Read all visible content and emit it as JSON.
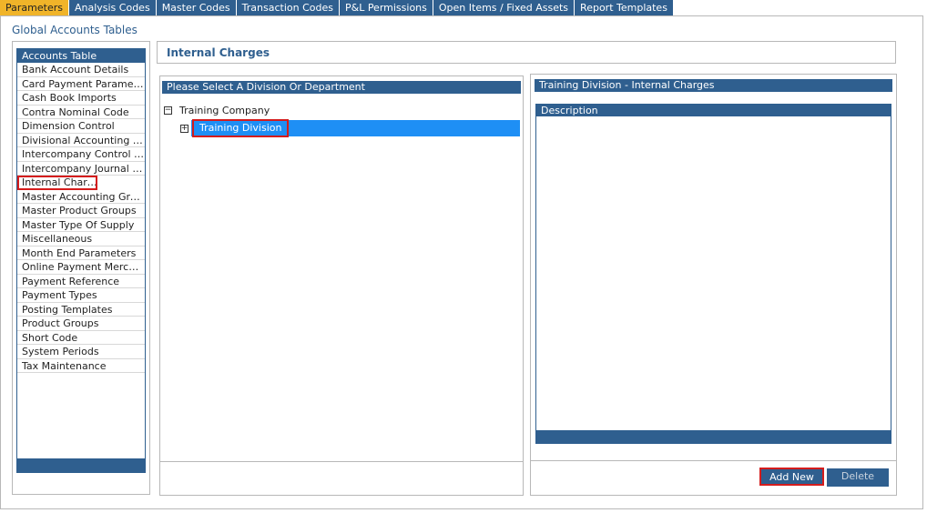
{
  "tabs": [
    {
      "label": "Parameters",
      "active": true
    },
    {
      "label": "Analysis Codes"
    },
    {
      "label": "Master Codes"
    },
    {
      "label": "Transaction Codes"
    },
    {
      "label": "P&L Permissions"
    },
    {
      "label": "Open Items / Fixed Assets"
    },
    {
      "label": "Report Templates"
    }
  ],
  "section_title": "Global Accounts Tables",
  "sidebar": {
    "header": "Accounts Table",
    "items": [
      "Bank Account Details",
      "Card Payment Parameters",
      "Cash Book Imports",
      "Contra Nominal Code",
      "Dimension Control",
      "Divisional Accounting Gro...",
      "Intercompany Control Co...",
      "Intercompany Journal Co...",
      "Internal Charges",
      "Master Accounting Groups",
      "Master Product Groups",
      "Master Type Of Supply",
      "Miscellaneous",
      "Month End Parameters",
      "Online Payment Merchants",
      "Payment Reference",
      "Payment Types",
      "Posting Templates",
      "Product Groups",
      "Short Code",
      "System Periods",
      "Tax Maintenance"
    ]
  },
  "page_title": "Internal Charges",
  "tree": {
    "header": "Please Select A Division Or Department",
    "root_label": "Training Company",
    "root_toggle": "−",
    "child_label": "Training Division",
    "child_toggle": "+"
  },
  "details": {
    "header": "Training Division - Internal Charges",
    "column_header": "Description"
  },
  "buttons": {
    "add_new": "Add New",
    "delete": "Delete"
  },
  "colors": {
    "accent": "#2f5f8f",
    "active_tab": "#f0b429",
    "selected_row": "#1e8ff5",
    "highlight": "#d41c1c"
  }
}
